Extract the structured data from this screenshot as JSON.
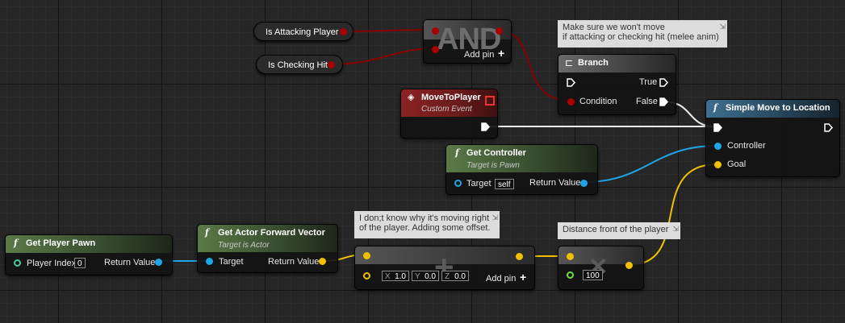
{
  "var_nodes": {
    "is_attacking_player": "Is Attacking Player",
    "is_checking_hit": "Is Checking Hit"
  },
  "and_node": {
    "symbol": "AND",
    "add_pin": "Add pin"
  },
  "branch": {
    "title": "Branch",
    "true_label": "True",
    "false_label": "False",
    "condition_label": "Condition",
    "comment": "Make sure we won't move\nif attacking or checking hit (melee anim)"
  },
  "custom_event": {
    "title": "MoveToPlayer",
    "subtitle": "Custom Event"
  },
  "simple_move": {
    "title": "Simple Move to Location",
    "controller_label": "Controller",
    "goal_label": "Goal"
  },
  "get_controller": {
    "title": "Get Controller",
    "subtitle": "Target is Pawn",
    "target_label": "Target",
    "target_value": "self",
    "return_label": "Return Value"
  },
  "get_player_pawn": {
    "title": "Get Player Pawn",
    "index_label": "Player Index",
    "index_value": "0",
    "return_label": "Return Value"
  },
  "forward_vector": {
    "title": "Get Actor Forward Vector",
    "subtitle": "Target is Actor",
    "target_label": "Target",
    "return_label": "Return Value"
  },
  "add_node": {
    "comment": "I don;t know why it's moving right\nof the player. Adding some offset.",
    "x_label": "X",
    "x_value": "1.0",
    "y_label": "Y",
    "y_value": "0.0",
    "z_label": "Z",
    "z_value": "0.0",
    "add_pin": "Add pin",
    "symbol": "+"
  },
  "multiply_node": {
    "comment": "Distance front of the player",
    "value": "100",
    "symbol": "×"
  },
  "icons": {
    "add": "plus-icon",
    "branch": "branch-icon",
    "function": "function-icon",
    "event": "event-diamond-icon",
    "comment_pin": "pin-icon"
  },
  "colors": {
    "exec": "#ffffff",
    "bool": "#a00000",
    "object": "#1ea6e8",
    "vector": "#f0c000",
    "float": "#6fe03a"
  }
}
